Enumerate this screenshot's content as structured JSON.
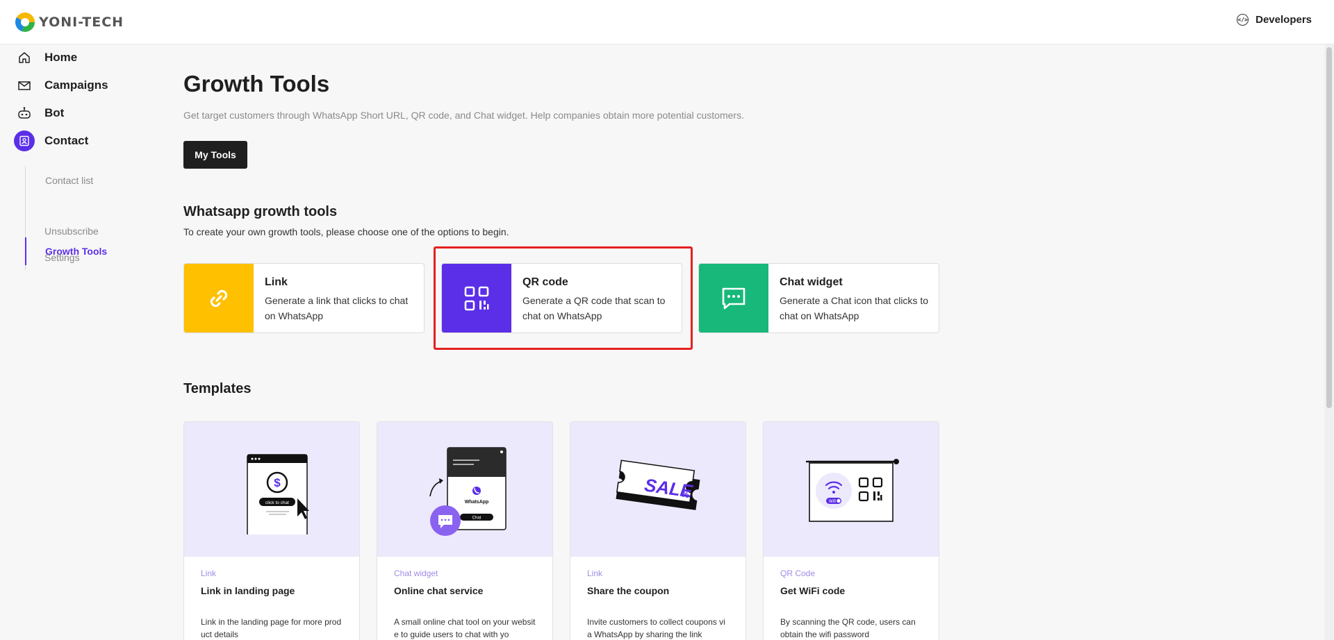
{
  "header": {
    "logo_text": "YONI-TECH",
    "developers_label": "Developers",
    "developers_icon": "code-icon"
  },
  "sidebar": {
    "items": [
      {
        "label": "Home",
        "icon": "home-icon"
      },
      {
        "label": "Campaigns",
        "icon": "mail-icon"
      },
      {
        "label": "Bot",
        "icon": "robot-icon"
      },
      {
        "label": "Contact",
        "icon": "contact-icon",
        "active": true
      }
    ],
    "sub_items": [
      {
        "label": "Contact list"
      },
      {
        "label": "Growth Tools",
        "active": true
      },
      {
        "label": "Unsubscribe"
      },
      {
        "label": "Settings"
      }
    ]
  },
  "main": {
    "title": "Growth Tools",
    "description": "Get target customers through WhatsApp Short URL, QR code, and Chat widget. Help companies obtain more potential customers.",
    "my_tools_label": "My Tools",
    "growth_section": {
      "title": "Whatsapp growth tools",
      "description": "To create your own growth tools, please choose one of the options to begin."
    },
    "tools": [
      {
        "name": "Link",
        "description": "Generate a link that clicks to chat on WhatsApp",
        "color": "#ffc000",
        "icon": "link-icon"
      },
      {
        "name": "QR code",
        "description": "Generate a QR code that scan to chat on WhatsApp",
        "color": "#5b2ee8",
        "icon": "qr-code-icon"
      },
      {
        "name": "Chat widget",
        "description": "Generate a Chat icon that clicks to chat on WhatsApp",
        "color": "#17b87a",
        "icon": "chat-icon"
      }
    ],
    "templates_title": "Templates",
    "templates": [
      {
        "category": "Link",
        "name": "Link in landing page",
        "description": "Link in the landing page for more product details",
        "button_text": "click to chat"
      },
      {
        "category": "Chat widget",
        "name": "Online chat service",
        "description": "A small online chat tool on your website to guide users to chat with yo",
        "brand_text": "WhatsApp",
        "button_text": "Chat"
      },
      {
        "category": "Link",
        "name": "Share the coupon",
        "description": "Invite customers to collect coupons via WhatsApp by sharing the link",
        "coupon_text": "SALE",
        "coupon_symbol": "%"
      },
      {
        "category": "QR Code",
        "name": "Get WiFi code",
        "description": "By scanning the QR code, users can obtain the wifi password",
        "badge_text": "Wifi"
      }
    ]
  },
  "colors": {
    "accent": "#5b2ee8",
    "highlight": "#e4201f",
    "template_bg": "#ede9fc"
  }
}
